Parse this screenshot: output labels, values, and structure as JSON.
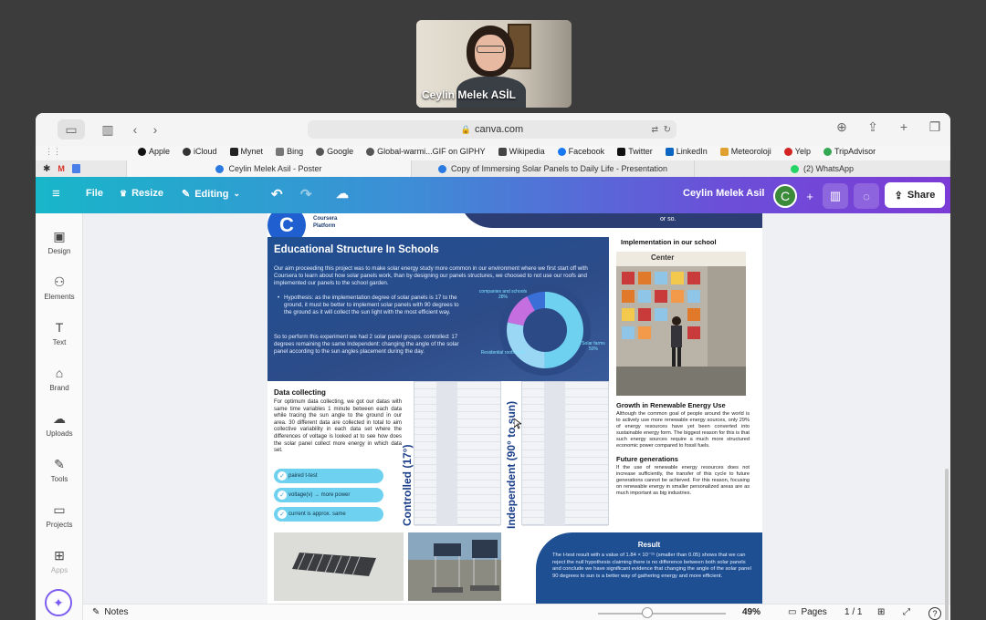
{
  "video": {
    "participant_name": "Ceylin Melek ASİL"
  },
  "browser": {
    "url": "canva.com",
    "bookmarks": [
      "Apple",
      "iCloud",
      "Mynet",
      "Bing",
      "Google",
      "Global-warmi...GIF on GIPHY",
      "Wikipedia",
      "Facebook",
      "Twitter",
      "LinkedIn",
      "Meteoroloji",
      "Yelp",
      "TripAdvisor"
    ],
    "tabs": [
      {
        "label": "Ceylin Melek Asil - Poster"
      },
      {
        "label": "Copy of Immersing Solar Panels to Daily Life - Presentation"
      },
      {
        "label": "(2) WhatsApp"
      }
    ]
  },
  "canva_header": {
    "file_label": "File",
    "resize_label": "Resize",
    "editing_label": "Editing",
    "user_name": "Ceylin Melek Asil",
    "avatar_letter": "C",
    "share_label": "Share"
  },
  "sidebar": {
    "items": [
      {
        "label": "Design",
        "icon": "design-icon"
      },
      {
        "label": "Elements",
        "icon": "elements-icon"
      },
      {
        "label": "Text",
        "icon": "text-icon"
      },
      {
        "label": "Brand",
        "icon": "brand-icon"
      },
      {
        "label": "Uploads",
        "icon": "uploads-icon"
      },
      {
        "label": "Tools",
        "icon": "tools-icon"
      },
      {
        "label": "Projects",
        "icon": "projects-icon"
      },
      {
        "label": "Apps",
        "icon": "apps-icon"
      }
    ]
  },
  "poster": {
    "coursera_line1": "Coursera",
    "coursera_line2": "Platform",
    "top_right_text": "or so.",
    "edu_title": "Educational Structure In Schools",
    "edu_intro": "Our aim proceeding this project was to make solar energy study more common in our environment where we first start off with Coursera to learn about how solar panels work, than by designing our panels structures, we choosed to not use our roofs and implemented our panels to the school garden.",
    "edu_hypothesis": "Hypothesis: as the implementation degree of solar panels is 17 to the ground, it must be better to implement solar panels with 90 degrees to the ground as it will collect the sun light with the most efficient way.",
    "edu_perform": "So to perform this experiment we had 2 solar panel groups. controlled: 17 degrees remaining the same Independent: changing the angle of the solar panel according to the sun angles placement during the day.",
    "donut_labels": [
      "companies and schools 28%",
      "Solar farms 50%",
      "Residential roofs 14%"
    ],
    "impl_title": "Implementation in our school",
    "photo_sign": "Center",
    "data_title": "Data collecting",
    "data_text": "For optimum data collecting, we got our datas with same time variables 1 minute between each data while tracing the sun angle to the ground in our area. 30 different data are collected in total to aim collective variability in each data set where the differences of voltage is looked at to see how does the solar panel collect more energy in which data set.",
    "pills": [
      "paired t-test",
      "voltage(v) → more power",
      "current is approx. same"
    ],
    "controlled_label": "Controlled (17°)",
    "independent_label": "Independent (90° to sun)",
    "growth_title": "Growth in Renewable Energy Use",
    "growth_text": "Although the common goal of people around the world is to actively use more renewable energy sources, only 29% of energy resources have yet been converted into sustainable energy form. The biggest reason for this is that such energy sources require a much more structured economic power compared to fossil fuels.",
    "future_title": "Future generations",
    "future_text": "If the use of renewable energy resources does not increase sufficiently, the transfer of this cycle to future generations cannot be achieved. For this reason, focusing on renewable energy in smaller personalized areas are as much important as big industries.",
    "result_title": "Result",
    "result_text": "The t-test result with a value of 1.84 × 10⁻¹⁵ (smaller than 0.05) shows that we can reject the null hypothesis claiming there is no difference between both solar panels and conclude we have significant evidence that changing the angle of the solar panel 90 degrees to sun is a better way of gathering energy and more efficient."
  },
  "bottom_bar": {
    "notes_label": "Notes",
    "zoom": "49%",
    "pages_label": "Pages",
    "page_count": "1 / 1"
  },
  "colors": {
    "header_start": "#18b6c9",
    "header_end": "#7c3bd6",
    "poster_blue": "#1f4f93",
    "pill": "#6fd1f0"
  }
}
